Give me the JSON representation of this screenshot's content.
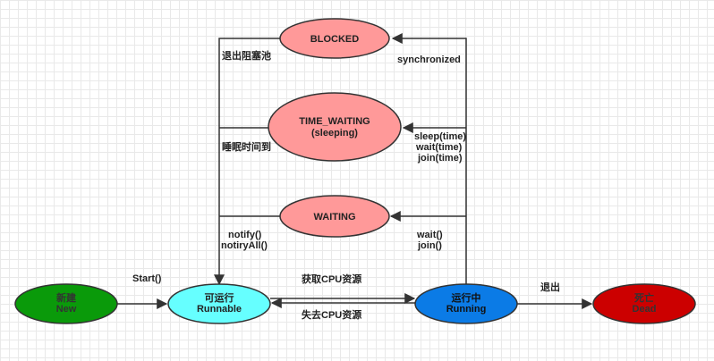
{
  "colors": {
    "new": "#0a9a0a",
    "runnable": "#66ffff",
    "running": "#0b7be6",
    "dead": "#cc0000",
    "waiting_states": "#ff9999",
    "stroke": "#333333"
  },
  "nodes": {
    "new": {
      "line1": "新建",
      "line2": "New"
    },
    "runnable": {
      "line1": "可运行",
      "line2": "Runnable"
    },
    "running": {
      "line1": "运行中",
      "line2": "Running"
    },
    "dead": {
      "line1": "死亡",
      "line2": "Dead"
    },
    "blocked": {
      "line1": "BLOCKED"
    },
    "time_waiting": {
      "line1": "TIME_WAITING",
      "line2": "(sleeping)"
    },
    "waiting": {
      "line1": "WAITING"
    }
  },
  "edges": {
    "start": "Start()",
    "get_cpu": "获取CPU资源",
    "lose_cpu": "失去CPU资源",
    "exit": "退出",
    "synchronized": "synchronized",
    "exit_blocking_pool": "退出阻塞池",
    "sleep_time": "sleep(time)",
    "wait_time": "wait(time)",
    "join_time": "join(time)",
    "sleep_done": "睡眠时间到",
    "wait": "wait()",
    "join": "join()",
    "notify": "notify()",
    "notify_all": "notiryAll()"
  }
}
